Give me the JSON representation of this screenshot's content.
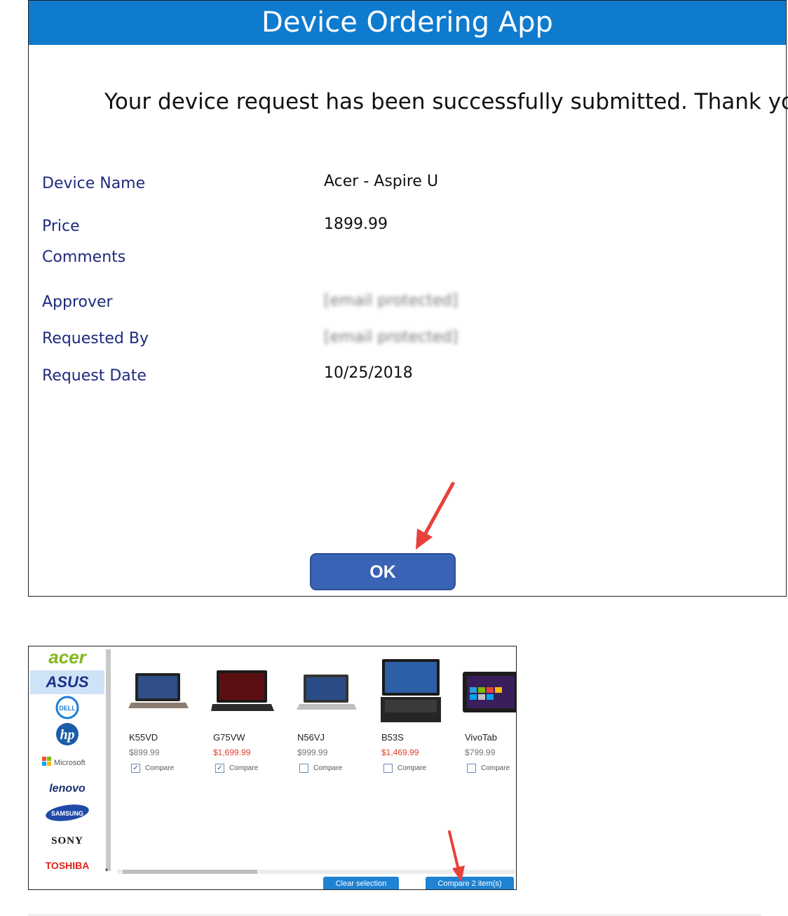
{
  "app": {
    "title": "Device Ordering App",
    "success_message": "Your device request has been successfully submitted. Thank you.",
    "fields": {
      "device_name": {
        "label": "Device Name",
        "value": "Acer - Aspire U"
      },
      "price": {
        "label": "Price",
        "value": "1899.99"
      },
      "comments": {
        "label": "Comments",
        "value": ""
      },
      "approver": {
        "label": "Approver",
        "value": "[email protected]"
      },
      "requested_by": {
        "label": "Requested By",
        "value": "[email protected]"
      },
      "request_date": {
        "label": "Request Date",
        "value": "10/25/2018"
      }
    },
    "ok_label": "OK"
  },
  "colors": {
    "header": "#0f7bcf",
    "label_text": "#1f2a7c",
    "ok_button": "#3a62b5",
    "annotation_arrow": "#e8413c",
    "sale_price": "#e03d2b",
    "action_button": "#1f82d2"
  },
  "catalog": {
    "brands": [
      {
        "name": "acer",
        "selected": false
      },
      {
        "name": "ASUS",
        "selected": true
      },
      {
        "name": "DELL",
        "selected": false
      },
      {
        "name": "hp",
        "selected": false
      },
      {
        "name": "Microsoft",
        "selected": false
      },
      {
        "name": "lenovo",
        "selected": false
      },
      {
        "name": "SAMSUNG",
        "selected": false
      },
      {
        "name": "SONY",
        "selected": false
      },
      {
        "name": "TOSHIBA",
        "selected": false
      }
    ],
    "products": [
      {
        "name": "K55VD",
        "price": "$899.99",
        "on_sale": false,
        "compare_label": "Compare",
        "checked": true
      },
      {
        "name": "G75VW",
        "price": "$1,699.99",
        "on_sale": true,
        "compare_label": "Compare",
        "checked": true
      },
      {
        "name": "N56VJ",
        "price": "$999.99",
        "on_sale": false,
        "compare_label": "Compare",
        "checked": false
      },
      {
        "name": "B53S",
        "price": "$1,469.99",
        "on_sale": true,
        "compare_label": "Compare",
        "checked": false
      },
      {
        "name": "VivoTab",
        "price": "$799.99",
        "on_sale": false,
        "compare_label": "Compare",
        "checked": false
      }
    ],
    "clear_label": "Clear selection",
    "compare_label": "Compare 2 item(s)"
  }
}
